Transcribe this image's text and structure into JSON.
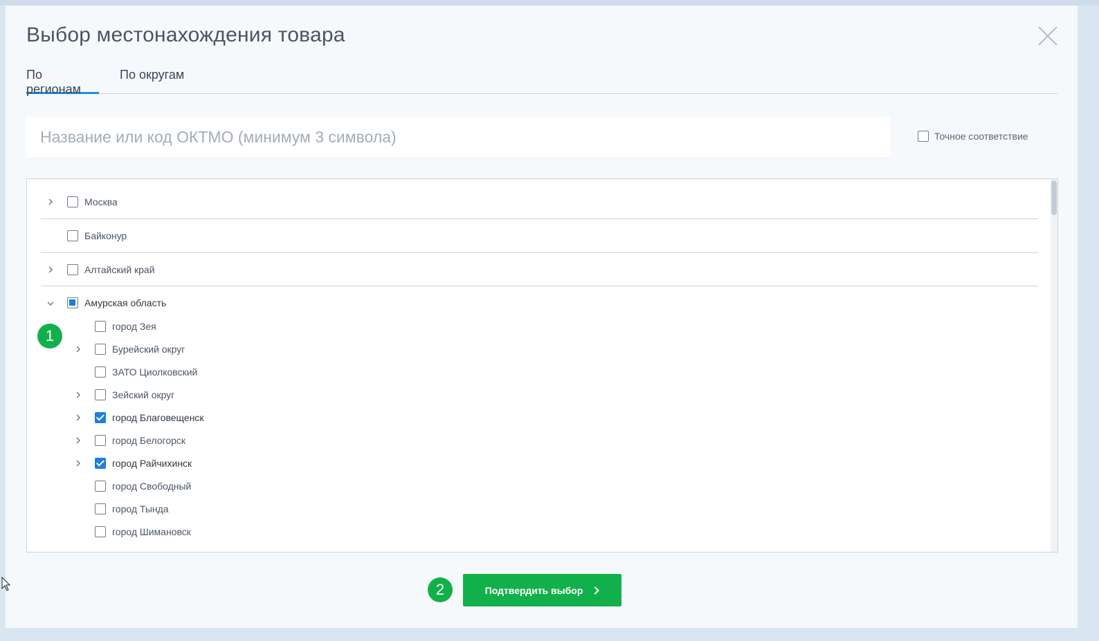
{
  "modal": {
    "title": "Выбор местонахождения товара",
    "tabs": [
      {
        "label": "По регионам",
        "active": true
      },
      {
        "label": "По округам",
        "active": false
      }
    ],
    "search": {
      "placeholder": "Название или код ОКТМО (минимум 3 символа)",
      "value": ""
    },
    "exact_match": {
      "label": "Точное соответствие",
      "checked": false
    },
    "tree": {
      "top_items": [
        {
          "label": "Москва",
          "expandable": true,
          "checked": false
        },
        {
          "label": "Байконур",
          "expandable": false,
          "checked": false
        },
        {
          "label": "Алтайский край",
          "expandable": true,
          "checked": false
        },
        {
          "label": "Амурская область",
          "expandable": true,
          "expanded": true,
          "state": "partial"
        }
      ],
      "children": [
        {
          "label": "город Зея",
          "expandable": false,
          "checked": false
        },
        {
          "label": "Бурейский округ",
          "expandable": true,
          "checked": false
        },
        {
          "label": "ЗАТО Циолковский",
          "expandable": false,
          "checked": false
        },
        {
          "label": "Зейский округ",
          "expandable": true,
          "checked": false
        },
        {
          "label": "город Благовещенск",
          "expandable": true,
          "checked": true
        },
        {
          "label": "город Белогорск",
          "expandable": true,
          "checked": false
        },
        {
          "label": "город Райчихинск",
          "expandable": true,
          "checked": true
        },
        {
          "label": "город Свободный",
          "expandable": false,
          "checked": false
        },
        {
          "label": "город Тында",
          "expandable": false,
          "checked": false
        },
        {
          "label": "город Шимановск",
          "expandable": false,
          "checked": false
        }
      ]
    },
    "badges": {
      "one": "1",
      "two": "2"
    },
    "confirm_label": "Подтвердить выбор"
  },
  "colors": {
    "accent": "#1c7fdc",
    "confirm": "#12b04a",
    "badge": "#12b04a"
  }
}
